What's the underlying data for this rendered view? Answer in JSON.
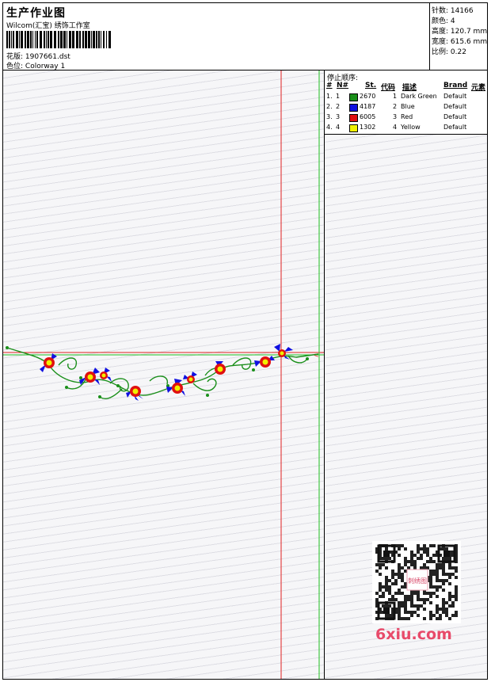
{
  "header": {
    "title": "生产作业图",
    "subtitle": "Wilcom(汇宝) 绣饰工作室",
    "design_file_label": "花版:",
    "design_file": "1907661.dst",
    "colorway_label": "色位:",
    "colorway": "Colorway 1"
  },
  "stats": {
    "stitches_label": "针数:",
    "stitches": "14166",
    "colors_label": "颜色:",
    "colors": "4",
    "height_label": "高度:",
    "height": "120.7 mm",
    "width_label": "宽度:",
    "width": "615.6 mm",
    "scale_label": "比例:",
    "scale": "0.22"
  },
  "sequence": {
    "title": "停止顺序:",
    "columns": [
      "#",
      "N#",
      "St.",
      "代码",
      "描述",
      "Brand",
      "元素"
    ],
    "rows": [
      {
        "num": "1.",
        "n": "1",
        "st": "2670",
        "code": "1",
        "desc": "Dark Green",
        "brand": "Default",
        "color": "#1a8f1a"
      },
      {
        "num": "2.",
        "n": "2",
        "st": "4187",
        "code": "2",
        "desc": "Blue",
        "brand": "Default",
        "color": "#1010e0"
      },
      {
        "num": "3.",
        "n": "3",
        "st": "6005",
        "code": "3",
        "desc": "Red",
        "brand": "Default",
        "color": "#e01010"
      },
      {
        "num": "4.",
        "n": "4",
        "st": "1302",
        "code": "4",
        "desc": "Yellow",
        "brand": "Default",
        "color": "#f0f000"
      }
    ]
  },
  "watermark": {
    "site": "6xiu.com",
    "seal": "刺绣图"
  }
}
